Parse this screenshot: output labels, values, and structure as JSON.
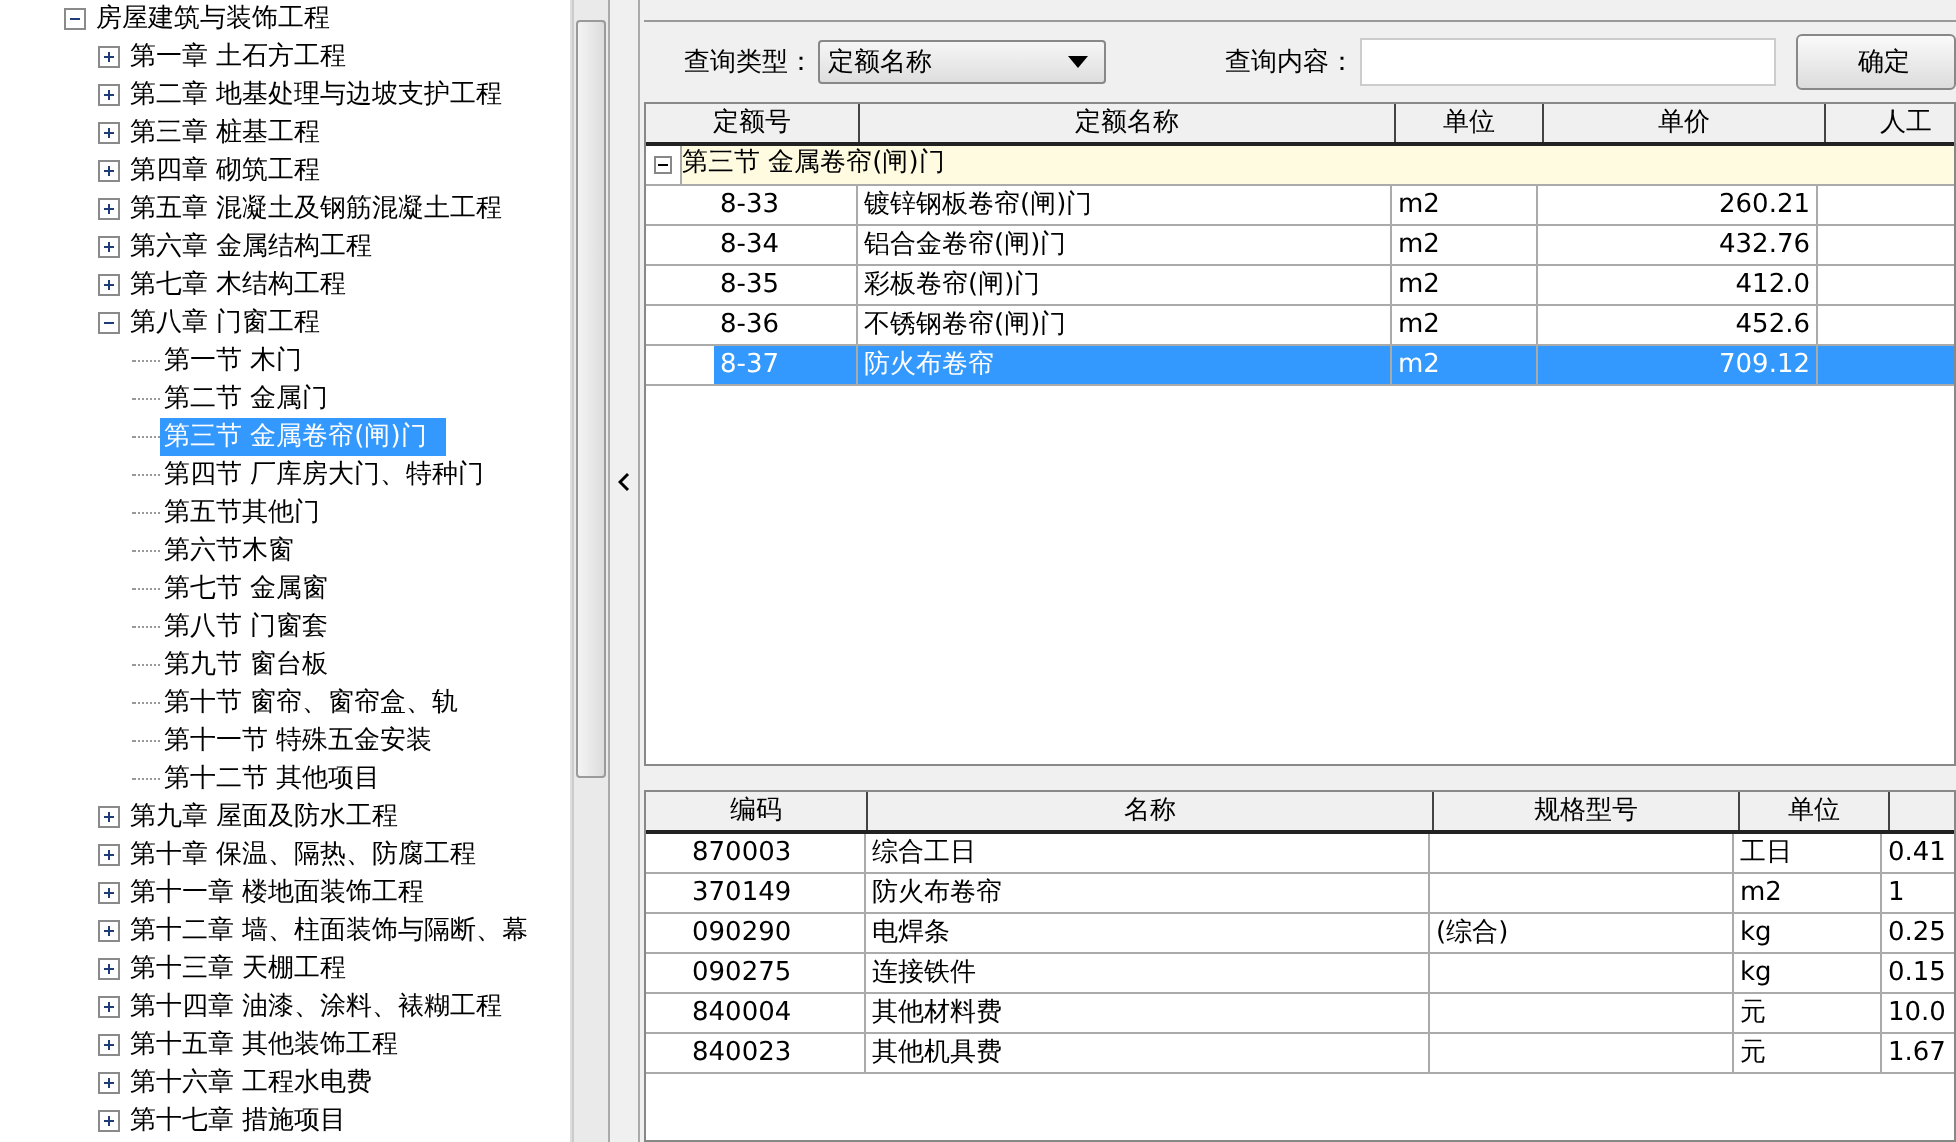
{
  "tree": [
    {
      "label": "房屋建筑与装饰工程",
      "expanded": true,
      "selected": false,
      "children": [
        {
          "label": "第一章  土石方工程",
          "expanded": false,
          "selected": false
        },
        {
          "label": "第二章  地基处理与边坡支护工程",
          "expanded": false,
          "selected": false
        },
        {
          "label": "第三章  桩基工程",
          "expanded": false,
          "selected": false
        },
        {
          "label": "第四章  砌筑工程",
          "expanded": false,
          "selected": false
        },
        {
          "label": "第五章  混凝土及钢筋混凝土工程",
          "expanded": false,
          "selected": false
        },
        {
          "label": "第六章  金属结构工程",
          "expanded": false,
          "selected": false
        },
        {
          "label": "第七章  木结构工程",
          "expanded": false,
          "selected": false
        },
        {
          "label": "第八章  门窗工程",
          "expanded": true,
          "selected": false,
          "children": [
            {
              "label": "第一节  木门",
              "selected": false
            },
            {
              "label": "第二节  金属门",
              "selected": false
            },
            {
              "label": "第三节  金属卷帘(闸)门",
              "selected": true
            },
            {
              "label": "第四节  厂库房大门、特种门",
              "selected": false
            },
            {
              "label": "第五节其他门",
              "selected": false
            },
            {
              "label": "第六节木窗",
              "selected": false
            },
            {
              "label": "第七节  金属窗",
              "selected": false
            },
            {
              "label": "第八节  门窗套",
              "selected": false
            },
            {
              "label": "第九节  窗台板",
              "selected": false
            },
            {
              "label": "第十节  窗帘、窗帘盒、轨",
              "selected": false
            },
            {
              "label": "第十一节  特殊五金安装",
              "selected": false
            },
            {
              "label": "第十二节  其他项目",
              "selected": false
            }
          ]
        },
        {
          "label": "第九章  屋面及防水工程",
          "expanded": false,
          "selected": false
        },
        {
          "label": "第十章  保温、隔热、防腐工程",
          "expanded": false,
          "selected": false
        },
        {
          "label": "第十一章  楼地面装饰工程",
          "expanded": false,
          "selected": false
        },
        {
          "label": "第十二章  墙、柱面装饰与隔断、幕",
          "expanded": false,
          "selected": false
        },
        {
          "label": "第十三章  天棚工程",
          "expanded": false,
          "selected": false
        },
        {
          "label": "第十四章  油漆、涂料、裱糊工程",
          "expanded": false,
          "selected": false
        },
        {
          "label": "第十五章  其他装饰工程",
          "expanded": false,
          "selected": false
        },
        {
          "label": "第十六章  工程水电费",
          "expanded": false,
          "selected": false
        },
        {
          "label": "第十七章  措施项目",
          "expanded": false,
          "selected": false
        }
      ]
    }
  ],
  "query": {
    "type_label": "查询类型：",
    "type_value": "定额名称",
    "content_label": "查询内容：",
    "confirm_button": "确定"
  },
  "quota_table": {
    "columns": [
      "定额号",
      "定额名称",
      "单位",
      "单价",
      "人工"
    ],
    "group": {
      "label": "第三节  金属卷帘(闸)门",
      "expanded": true
    },
    "rows": [
      {
        "cells": [
          "8-33",
          "镀锌钢板卷帘(闸)门",
          "m2",
          "260.21"
        ],
        "selected": false
      },
      {
        "cells": [
          "8-34",
          "铝合金卷帘(闸)门",
          "m2",
          "432.76"
        ],
        "selected": false
      },
      {
        "cells": [
          "8-35",
          "彩板卷帘(闸)门",
          "m2",
          "412.0"
        ],
        "selected": false
      },
      {
        "cells": [
          "8-36",
          "不锈钢卷帘(闸)门",
          "m2",
          "452.6"
        ],
        "selected": false
      },
      {
        "cells": [
          "8-37",
          "防火布卷帘",
          "m2",
          "709.12"
        ],
        "selected": true
      }
    ]
  },
  "material_table": {
    "columns": [
      "编码",
      "名称",
      "规格型号",
      "单位"
    ],
    "rows": [
      [
        "870003",
        "综合工日",
        "",
        "工日",
        "0.41"
      ],
      [
        "370149",
        "防火布卷帘",
        "",
        "m2",
        "1"
      ],
      [
        "090290",
        "电焊条",
        "(综合)",
        "kg",
        "0.25"
      ],
      [
        "090275",
        "连接铁件",
        "",
        "kg",
        "0.15"
      ],
      [
        "840004",
        "其他材料费",
        "",
        "元",
        "10.0"
      ],
      [
        "840023",
        "其他机具费",
        "",
        "元",
        "1.67"
      ]
    ]
  }
}
